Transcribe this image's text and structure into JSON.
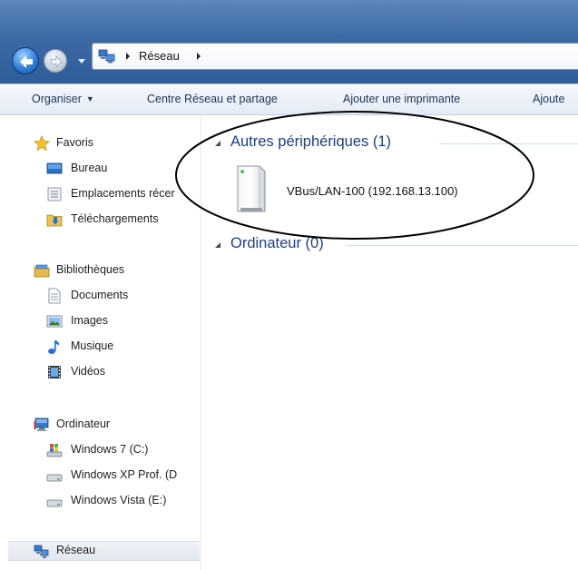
{
  "address_bar": {
    "crumbs": [
      "Réseau"
    ],
    "back_icon": "back-arrow-icon",
    "forward_icon": "forward-arrow-icon",
    "network_icon": "network-icon"
  },
  "command_bar": {
    "organize": "Organiser",
    "network_center": "Centre Réseau et partage",
    "add_printer": "Ajouter une imprimante",
    "add_truncated": "Ajoute"
  },
  "nav_pane": {
    "favorites": {
      "label": "Favoris",
      "items": [
        "Bureau",
        "Emplacements récer",
        "Téléchargements"
      ]
    },
    "libraries": {
      "label": "Bibliothèques",
      "items": [
        "Documents",
        "Images",
        "Musique",
        "Vidéos"
      ]
    },
    "computer": {
      "label": "Ordinateur",
      "items": [
        "Windows 7 (C:)",
        "Windows XP Prof. (D",
        "Windows Vista (E:)"
      ]
    },
    "network": {
      "label": "Réseau",
      "selected": true
    }
  },
  "content": {
    "groups": [
      {
        "title": "Autres périphériques (1)",
        "items": [
          {
            "name": "VBus/LAN-100 (192.168.13.100)",
            "icon": "network-device-icon"
          }
        ]
      },
      {
        "title": "Ordinateur (0)",
        "items": []
      }
    ]
  },
  "colors": {
    "title_gradient_top": "#5d87bd",
    "group_title": "#1e3f8a",
    "annotation": "#000000"
  }
}
